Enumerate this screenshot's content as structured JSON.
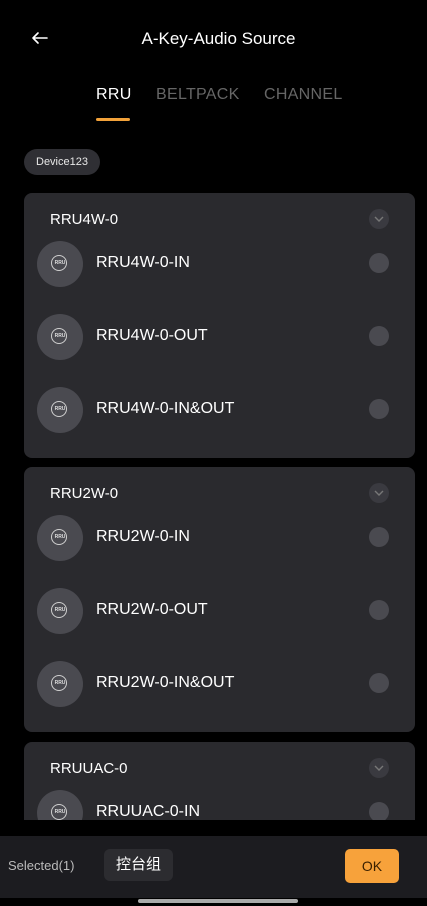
{
  "header": {
    "title": "A-Key-Audio Source"
  },
  "tabs": [
    {
      "label": "RRU",
      "active": true
    },
    {
      "label": "BELTPACK",
      "active": false
    },
    {
      "label": "CHANNEL",
      "active": false
    }
  ],
  "device_chip": "Device123",
  "icon_text": "RRU",
  "groups": [
    {
      "title": "RRU4W-0",
      "items": [
        "RRU4W-0-IN",
        "RRU4W-0-OUT",
        "RRU4W-0-IN&OUT"
      ]
    },
    {
      "title": "RRU2W-0",
      "items": [
        "RRU2W-0-IN",
        "RRU2W-0-OUT",
        "RRU2W-0-IN&OUT"
      ]
    },
    {
      "title": "RRUUAC-0",
      "items": [
        "RRUUAC-0-IN"
      ]
    }
  ],
  "bottom": {
    "selected_label": "Selected(1)",
    "group_button": "控台组",
    "ok_button": "OK"
  },
  "colors": {
    "accent": "#f7a23b",
    "card": "#2a2a2e",
    "background": "#000000"
  }
}
